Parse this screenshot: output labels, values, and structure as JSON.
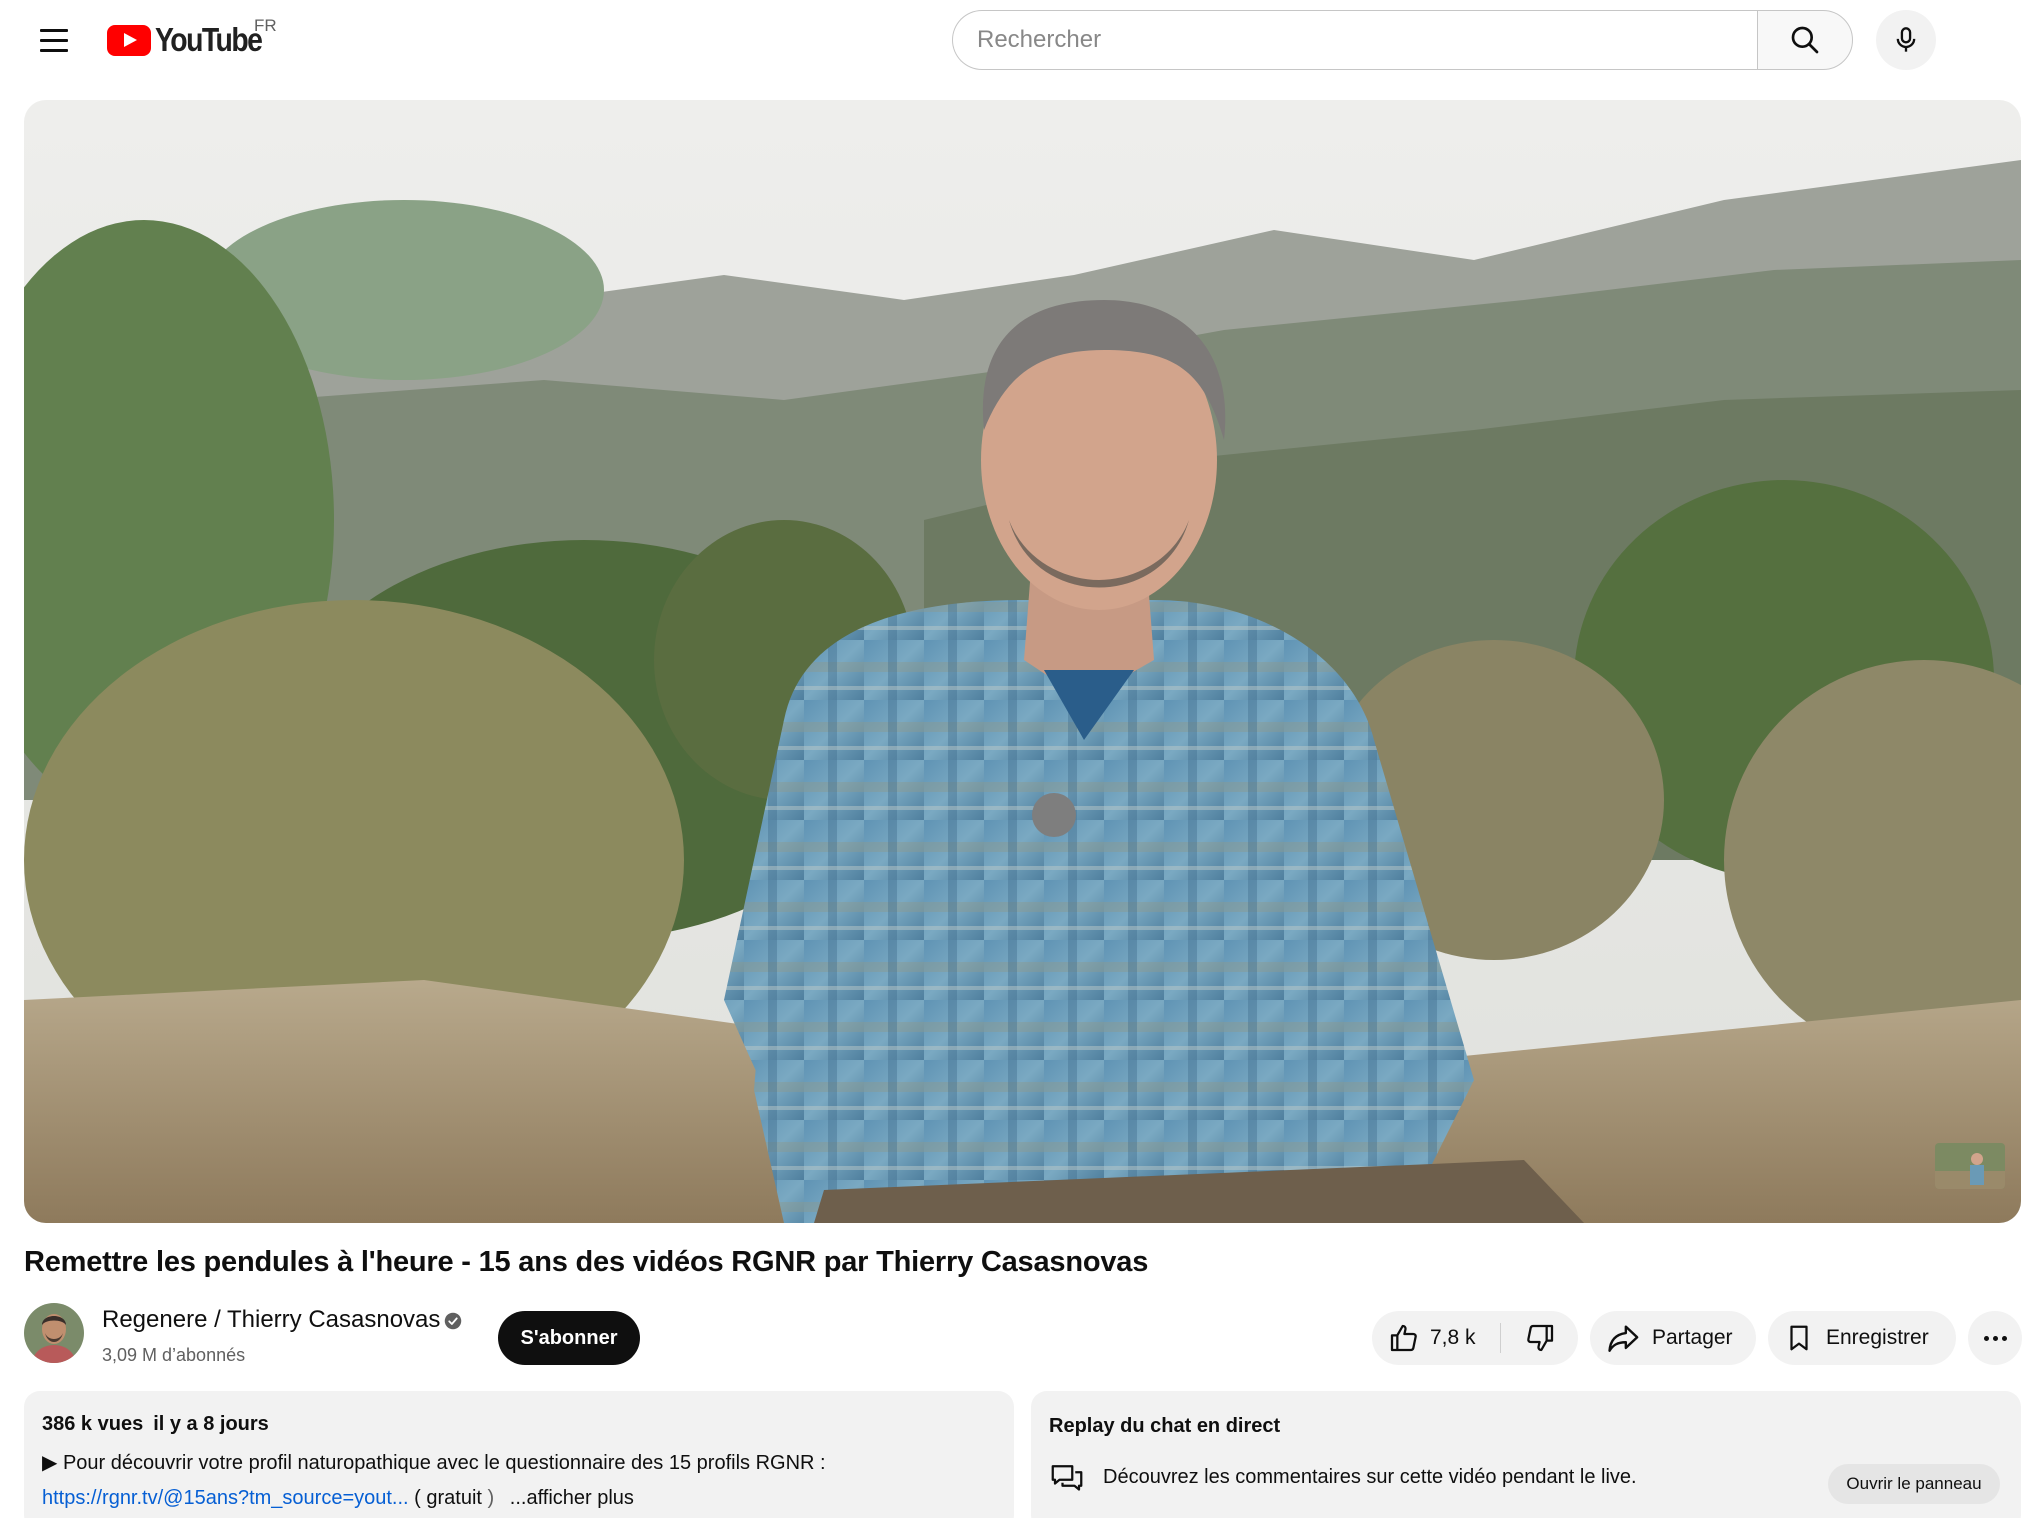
{
  "header": {
    "menu_icon": "hamburger-menu-icon",
    "logo_text": "YouTube",
    "country_code": "FR",
    "search_placeholder": "Rechercher",
    "search_icon": "search-icon",
    "mic_icon": "microphone-icon"
  },
  "video": {
    "title": "Remettre les pendules à l'heure - 15 ans des vidéos RGNR par Thierry Casasnovas"
  },
  "channel": {
    "name": "Regenere / Thierry Casasnovas",
    "verified_icon": "verified-check-icon",
    "subscribers": "3,09 M d’abonnés",
    "subscribe_label": "S'abonner"
  },
  "actions": {
    "likes": "7,8 k",
    "like_icon": "thumbs-up-icon",
    "dislike_icon": "thumbs-down-icon",
    "share_label": "Partager",
    "share_icon": "share-arrow-icon",
    "save_label": "Enregistrer",
    "save_icon": "bookmark-icon",
    "more_icon": "more-horizontal-icon"
  },
  "description": {
    "views": "386 k vues",
    "date": "il y a 8 jours",
    "line1": "▶ Pour découvrir votre profil naturopathique avec le questionnaire des 15 profils RGNR :",
    "link": "https://rgnr.tv/@15ans?tm_source=yout...",
    "paren_open": "( gratuit",
    "paren_close": ")",
    "show_more": "...afficher plus"
  },
  "chat_replay": {
    "title": "Replay du chat en direct",
    "icon": "chat-bubbles-icon",
    "text": "Découvrez les commentaires sur cette vidéo pendant le live.",
    "button_label": "Ouvrir le panneau"
  },
  "colors": {
    "brand_red": "#ff0000",
    "link_blue": "#065fd4",
    "pill_bg": "#f2f2f2",
    "subscribe_bg": "#0f0f0f"
  }
}
